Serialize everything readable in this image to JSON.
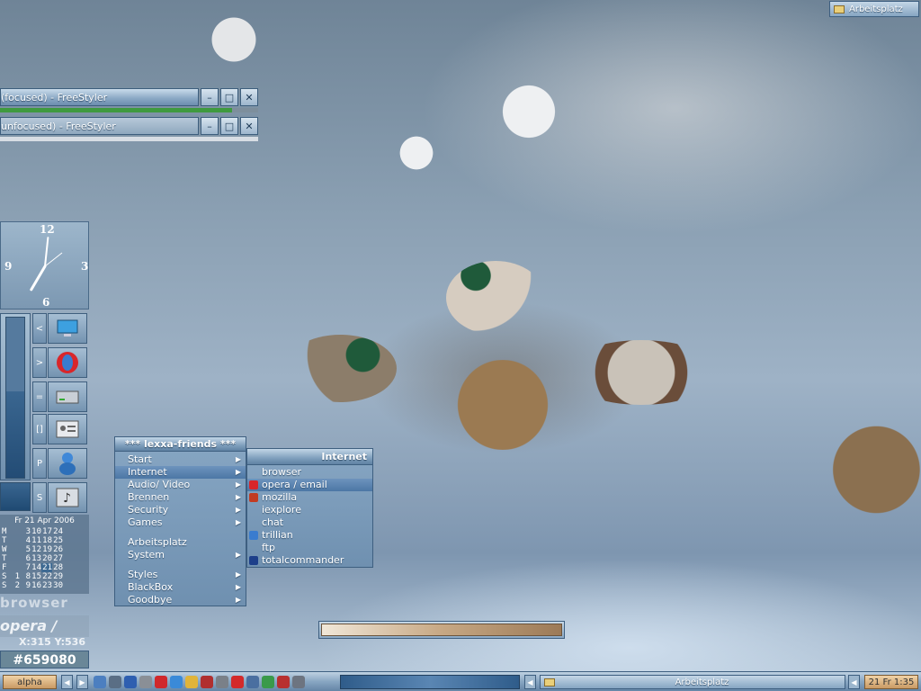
{
  "desktop": {
    "top_button": {
      "label": "Arbeitsplatz",
      "icon": "folder-icon"
    }
  },
  "windows": [
    {
      "title": "(focused) - FreeStyler",
      "state": "focused",
      "progress_color": "#3f9a3f",
      "progress_value": 0.9
    },
    {
      "title": "unfocused) - FreeStyler",
      "state": "unfocused",
      "progress_color": "#d7dde4",
      "progress_value": 1.0
    }
  ],
  "window_buttons": {
    "minimize": "–",
    "maximize": "□",
    "close": "✕"
  },
  "clock": {
    "numerals": [
      "12",
      "3",
      "6",
      "9"
    ],
    "hour": 7,
    "minute": 1
  },
  "dock": {
    "buttons": [
      "<",
      ">",
      "=",
      "[]",
      "P",
      "S"
    ],
    "icons": [
      "monitor-icon",
      "opera-icon",
      "drive-icon",
      "contact-card-icon",
      "messenger-icon",
      "music-icon"
    ]
  },
  "calendar": {
    "header": "Fr 21 Apr 2006",
    "rows": [
      [
        "M",
        "",
        "3",
        "10",
        "17",
        "24"
      ],
      [
        "T",
        "",
        "4",
        "11",
        "18",
        "25"
      ],
      [
        "W",
        "",
        "5",
        "12",
        "19",
        "26"
      ],
      [
        "T",
        "",
        "6",
        "13",
        "20",
        "27"
      ],
      [
        "F",
        "",
        "7",
        "14",
        "21",
        "28"
      ],
      [
        "S",
        "1",
        "8",
        "15",
        "22",
        "29"
      ],
      [
        "S",
        "2",
        "9",
        "16",
        "23",
        "30"
      ]
    ]
  },
  "status": {
    "app_text": "browser",
    "app_text2": "opera /",
    "coords": "X:315 Y:536",
    "color": "#659080"
  },
  "start_menu": {
    "title": "*** lexxa-friends ***",
    "items": [
      {
        "label": "Start",
        "submenu": true
      },
      {
        "label": "Internet",
        "submenu": true,
        "active": true
      },
      {
        "label": "Audio/ Video",
        "submenu": true
      },
      {
        "label": "Brennen",
        "submenu": true
      },
      {
        "label": "Security",
        "submenu": true
      },
      {
        "label": "Games",
        "submenu": true
      },
      {
        "label": "",
        "separator": true
      },
      {
        "label": "Arbeitsplatz",
        "submenu": false
      },
      {
        "label": "System",
        "submenu": true
      },
      {
        "label": "",
        "separator": true
      },
      {
        "label": "Styles",
        "submenu": true
      },
      {
        "label": "BlackBox",
        "submenu": true
      },
      {
        "label": "Goodbye",
        "submenu": true
      }
    ]
  },
  "internet_menu": {
    "title": "Internet",
    "items": [
      {
        "label": "browser",
        "icon": ""
      },
      {
        "label": "opera / email",
        "icon": "opera-icon",
        "active": true
      },
      {
        "label": "mozilla",
        "icon": "mozilla-icon"
      },
      {
        "label": "iexplore",
        "icon": ""
      },
      {
        "label": "chat",
        "icon": ""
      },
      {
        "label": "trillian",
        "icon": "trillian-icon"
      },
      {
        "label": "ftp",
        "icon": ""
      },
      {
        "label": "totalcommander",
        "icon": "floppy-icon"
      }
    ]
  },
  "taskbar": {
    "workspace": "alpha",
    "task_label": "Arbeitsplatz",
    "clock": "21 Fr 1:35",
    "tray_icons": [
      "shield-icon",
      "speaker-icon",
      "signal-icon",
      "tool-icon",
      "red-logo-icon",
      "globe-icon",
      "pencil-icon",
      "lifebuoy-icon",
      "gear-icon",
      "disc-icon",
      "monitor-icon",
      "network-icon",
      "close-icon",
      "settings-icon"
    ]
  },
  "colors": {
    "accent": "#5f82a3",
    "menu_active": "#4c77a5",
    "taskbar_clock_bg": "#e8c9a0"
  }
}
